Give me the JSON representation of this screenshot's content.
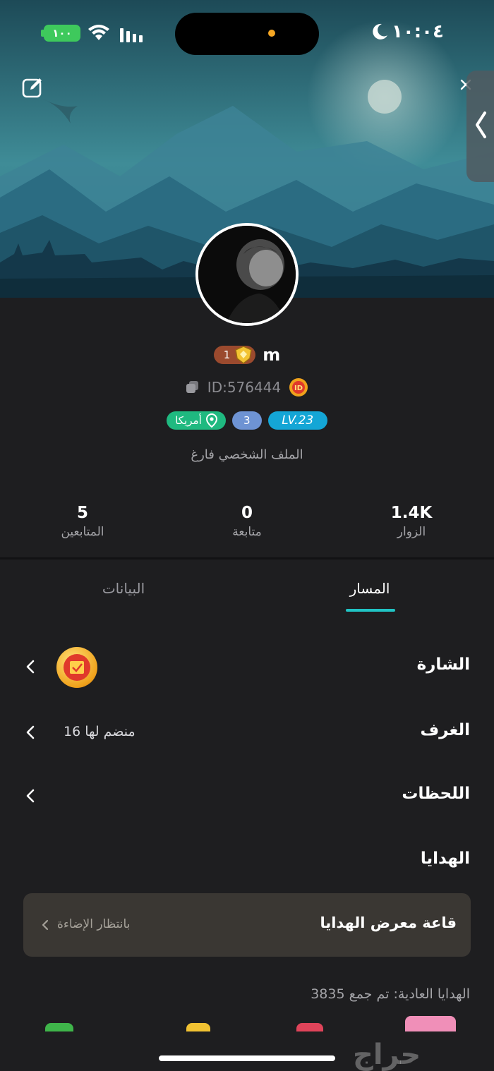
{
  "status_bar": {
    "battery": "١٠٠",
    "time": "١٠:٠٤"
  },
  "profile": {
    "username": "m",
    "rank_number": "1",
    "id_text": "ID:576444",
    "tags": {
      "country": "أمريكا",
      "number": "3",
      "level": "LV.23"
    },
    "bio": "الملف الشخصي فارغ"
  },
  "stats": {
    "visitors": {
      "value": "1.4K",
      "label": "الزوار"
    },
    "following": {
      "value": "0",
      "label": "متابعة"
    },
    "followers": {
      "value": "5",
      "label": "المتابعين"
    }
  },
  "tabs": {
    "path": "المسار",
    "data": "البيانات"
  },
  "rows": {
    "badge": {
      "label": "الشارة"
    },
    "rooms": {
      "label": "الغرف",
      "value": "16 منضم لها"
    },
    "moments": {
      "label": "اللحظات"
    },
    "gifts": {
      "label": "الهدايا"
    }
  },
  "gift_gallery": {
    "title": "قاعة معرض الهدايا",
    "status": "بانتظار الإضاءة"
  },
  "gifts_count": "الهدايا العادية: تم جمع 3835",
  "watermark": "حراج",
  "colors": {
    "accent": "#21c4c4",
    "background": "#1e1e20",
    "country_tag": "#1fb980",
    "level_tag": "#14a6d6",
    "number_tag": "#6e93d3",
    "rank_badge": "#9b4a2e"
  },
  "icons": [
    "edit-icon",
    "close-icon",
    "side-panel-chevron-icon",
    "copy-icon",
    "id-medal-icon",
    "location-pin-icon",
    "rank-shield-icon",
    "badge-medal-icon",
    "chevron-left-icon",
    "moon-icon",
    "wifi-icon",
    "signal-icon"
  ]
}
